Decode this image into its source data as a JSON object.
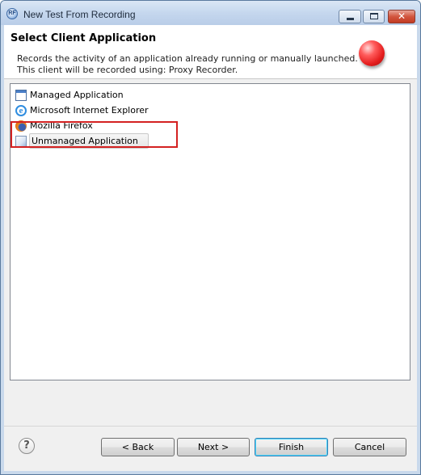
{
  "window": {
    "title": "New Test From Recording",
    "app_icon_text": "RF"
  },
  "titlebar_buttons": {
    "minimize": "minimize",
    "maximize": "maximize",
    "close": "✕"
  },
  "header": {
    "title": "Select Client Application",
    "description": "Records the activity of an application already running or manually launched. This client will be recorded using: Proxy Recorder."
  },
  "client_list": {
    "items": [
      {
        "label": "Managed Application",
        "icon": "managed-application-icon"
      },
      {
        "label": "Microsoft Internet Explorer",
        "icon": "internet-explorer-icon"
      },
      {
        "label": "Mozilla Firefox",
        "icon": "firefox-icon"
      },
      {
        "label": "Unmanaged Application",
        "icon": "unmanaged-application-icon",
        "selected": true
      }
    ]
  },
  "footer": {
    "help_glyph": "?",
    "back_label": "< Back",
    "next_label": "Next >",
    "finish_label": "Finish",
    "cancel_label": "Cancel"
  },
  "colors": {
    "highlight": "#d42121",
    "record_icon": "#e41d1d",
    "default_button_border": "#3c7fb1"
  }
}
